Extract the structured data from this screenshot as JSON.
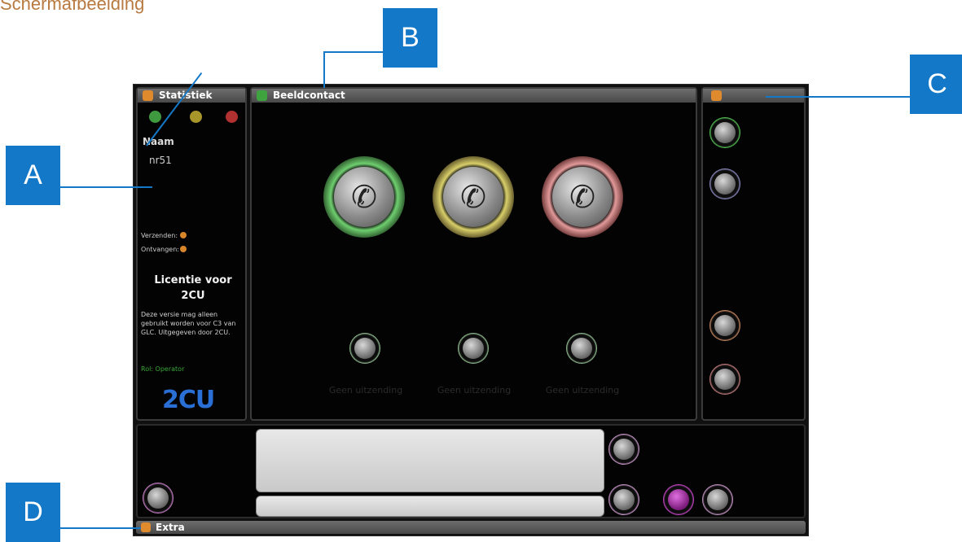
{
  "caption": "Schermafbeelding",
  "labels": {
    "a": "A",
    "b": "B",
    "c": "C",
    "d": "D"
  },
  "stats_panel": {
    "title": "Statistiek",
    "name_label": "Naam",
    "name_value": "nr51",
    "sent_label": "Verzenden:",
    "received_label": "Ontvangen:",
    "license_title": "Licentie voor 2CU",
    "license_text": "Deze versie mag alleen gebruikt worden voor C3 van GLC. Uitgegeven door 2CU.",
    "role": "Rol: Operator",
    "logo": "2CU",
    "status_colors": [
      "#3f9a3f",
      "#a8962b",
      "#b13030"
    ]
  },
  "video_panel": {
    "title": "Beeldcontact",
    "channels": [
      {
        "ring_color": "#6fcf6f",
        "status": "Geen uitzending"
      },
      {
        "ring_color": "#d9cf6a",
        "status": "Geen uitzending"
      },
      {
        "ring_color": "#e39a9a",
        "status": "Geen uitzending"
      }
    ]
  },
  "side_panel": {
    "buttons": [
      {
        "name": "side-contact-green-button",
        "ring": "#5cd65c"
      },
      {
        "name": "side-contact-purple-button",
        "ring": "#9a9ad6"
      },
      {
        "name": "side-call-orange-button",
        "ring": "#d9946a"
      },
      {
        "name": "side-hangup-pink-button",
        "ring": "#d98a8a"
      }
    ]
  },
  "bottom": {
    "extra_title": "Extra"
  }
}
